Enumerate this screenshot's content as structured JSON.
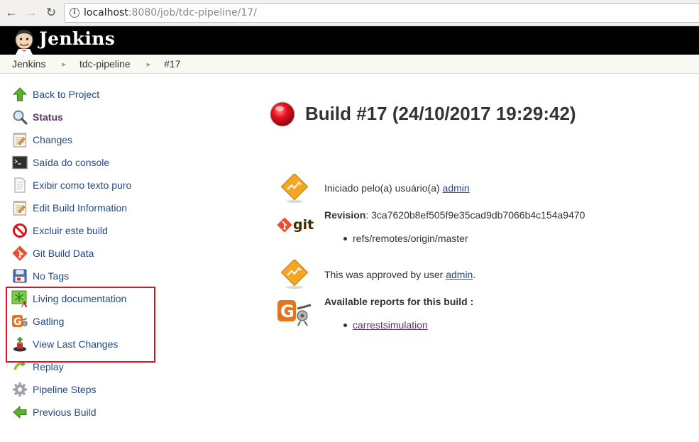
{
  "browser": {
    "url_host": "localhost",
    "url_rest": ":8080/job/tdc-pipeline/17/",
    "info_glyph": "i"
  },
  "header": {
    "app_title": "Jenkins"
  },
  "breadcrumb": [
    {
      "label": "Jenkins"
    },
    {
      "label": "tdc-pipeline"
    },
    {
      "label": "#17"
    }
  ],
  "sidebar": {
    "items": [
      {
        "label": "Back to Project",
        "icon": "up-arrow-icon"
      },
      {
        "label": "Status",
        "icon": "magnifier-icon",
        "active": true
      },
      {
        "label": "Changes",
        "icon": "notepad-icon"
      },
      {
        "label": "Saída do console",
        "icon": "terminal-icon"
      },
      {
        "label": "Exibir como texto puro",
        "icon": "document-icon"
      },
      {
        "label": "Edit Build Information",
        "icon": "notepad-edit-icon"
      },
      {
        "label": "Excluir este build",
        "icon": "no-entry-icon"
      },
      {
        "label": "Git Build Data",
        "icon": "git-icon"
      },
      {
        "label": "No Tags",
        "icon": "floppy-icon"
      },
      {
        "label": "Living documentation",
        "icon": "living-doc-icon"
      },
      {
        "label": "Gatling",
        "icon": "gatling-icon"
      },
      {
        "label": "View Last Changes",
        "icon": "last-changes-icon"
      },
      {
        "label": "Replay",
        "icon": "replay-icon"
      },
      {
        "label": "Pipeline Steps",
        "icon": "gear-icon"
      },
      {
        "label": "Previous Build",
        "icon": "left-arrow-icon"
      }
    ]
  },
  "main": {
    "build_title": "Build #17 (24/10/2017 19:29:42)",
    "status_color": "#e5101e",
    "started_by_prefix": "Iniciado pelo(a) usuário(a) ",
    "started_by_user": "admin",
    "revision_label": "Revision",
    "revision_value": ": 3ca7620b8ef505f9e35cad9db7066b4c154a9470",
    "git_logo_text": "git",
    "branch": "refs/remotes/origin/master",
    "approved_prefix": "This was approved by user ",
    "approved_user": "admin",
    "approved_suffix": ".",
    "reports_heading": "Available reports for this build :",
    "report_link": "carrestsimulation"
  }
}
